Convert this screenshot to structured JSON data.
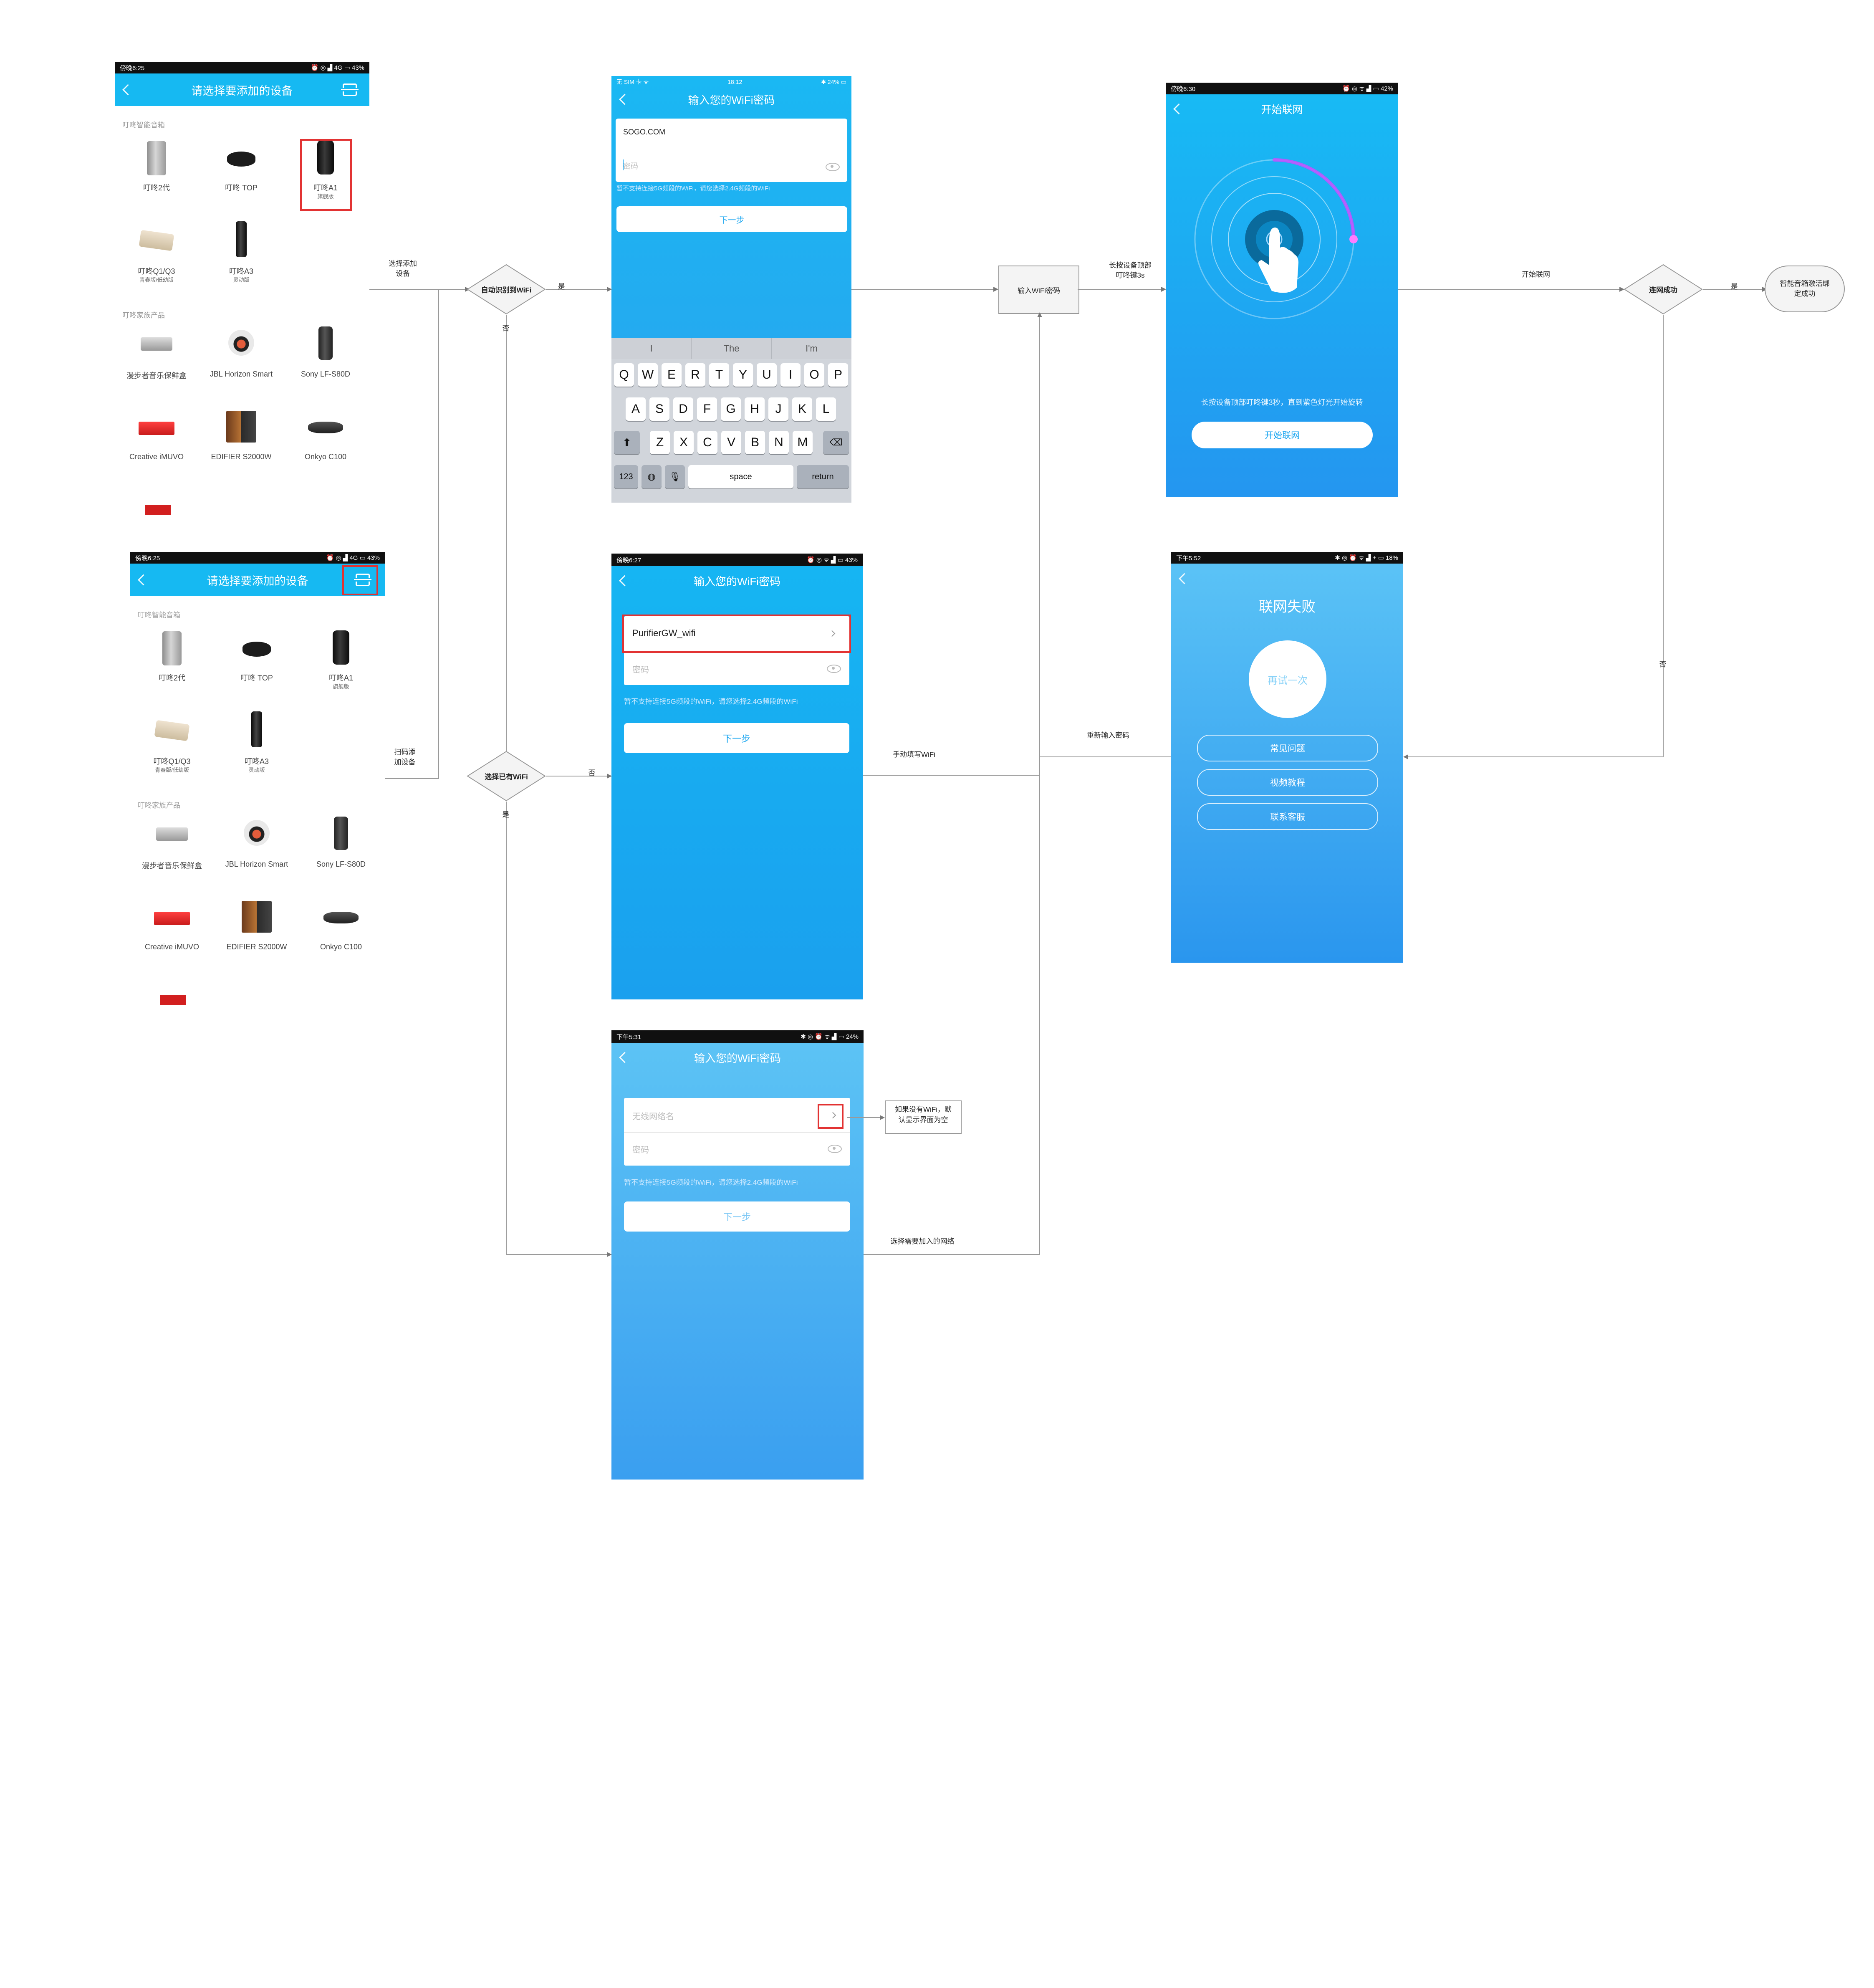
{
  "device_list": {
    "status_time": "傍晚6:25",
    "status_right": "⏰ ◎ ▟ 4G ▭ 43%",
    "title": "请选择要添加的设备",
    "section_smart": "叮咚智能音箱",
    "section_family": "叮咚家族产品",
    "items": [
      {
        "name": "叮咚2代",
        "sub": ""
      },
      {
        "name": "叮咚 TOP",
        "sub": ""
      },
      {
        "name": "叮咚A1",
        "sub": "旗舰版"
      },
      {
        "name": "叮咚Q1/Q3",
        "sub": "青春版/低幼版"
      },
      {
        "name": "叮咚A3",
        "sub": "灵动版"
      }
    ],
    "family_items": [
      {
        "name": "漫步者音乐保鲜盒"
      },
      {
        "name": "JBL Horizon Smart"
      },
      {
        "name": "Sony LF-S80D"
      },
      {
        "name": "Creative iMUVO"
      },
      {
        "name": "EDIFIER S2000W"
      },
      {
        "name": "Onkyo C100"
      }
    ]
  },
  "wifi_ios": {
    "status_left": "无 SIM 卡 ᯤ",
    "status_time": "18:12",
    "status_right": "✱ 24% ▭",
    "title": "输入您的WiFi密码",
    "ssid": "SOGO.COM",
    "password_placeholder": "密码",
    "hint": "暂不支持连接5G频段的WiFi，请您选择2.4G频段的WiFi",
    "next": "下一步",
    "suggestions": [
      "I",
      "The",
      "I'm"
    ],
    "row1": [
      "Q",
      "W",
      "E",
      "R",
      "T",
      "Y",
      "U",
      "I",
      "O",
      "P"
    ],
    "row2": [
      "A",
      "S",
      "D",
      "F",
      "G",
      "H",
      "J",
      "K",
      "L"
    ],
    "row3": [
      "Z",
      "X",
      "C",
      "V",
      "B",
      "N",
      "M"
    ],
    "num_key": "123",
    "space": "space",
    "return": "return"
  },
  "wifi_android": {
    "status_time": "傍晚6:27",
    "status_right": "⏰ ◎ ᯤ ▟ ▭ 43%",
    "title": "输入您的WiFi密码",
    "ssid": "PurifierGW_wifi",
    "password_placeholder": "密码",
    "hint": "暂不支持连接5G频段的WiFi，请您选择2.4G频段的WiFi",
    "next": "下一步"
  },
  "wifi_empty": {
    "status_time": "下午5:31",
    "status_right": "✱ ◎ ⏰ ᯤ ▟ ▭ 24%",
    "title": "输入您的WiFi密码",
    "ssid_placeholder": "无线网络名",
    "password_placeholder": "密码",
    "hint": "暂不支持连接5G频段的WiFi，请您选择2.4G频段的WiFi",
    "next": "下一步"
  },
  "connect": {
    "status_time": "傍晚6:30",
    "status_right": "⏰ ◎ ᯤ ▟ ▭ 42%",
    "title": "开始联网",
    "instruction": "长按设备顶部叮咚键3秒，直到紫色灯光开始旋转",
    "button": "开始联网"
  },
  "fail": {
    "status_time": "下午5:52",
    "status_right": "✱ ◎ ⏰ ᯤ ▟ + ▭ 18%",
    "title": "联网失败",
    "retry": "再试一次",
    "faq": "常见问题",
    "video": "视频教程",
    "contact": "联系客服"
  },
  "flow": {
    "select_add": "选择添加\n设备",
    "scan_add": "扫码添\n加设备",
    "auto_detect": "自动识别到WiFi",
    "choose_existing": "选择已有WiFi",
    "yes": "是",
    "no": "否",
    "enter_pwd": "输入WiFi密码",
    "long_press": "长按设备顶部\n叮咚键3s",
    "start_connect": "开始联网",
    "connected": "连网成功",
    "bind_done": "智能音箱激活绑\n定成功",
    "manual_wifi": "手动填写WiFi",
    "reenter_pwd": "重新输入密码",
    "select_network": "选择需要加入的网络",
    "no_wifi_note": "如果没有WiFi，默\n认显示界面为空"
  },
  "colors": {
    "accent": "#16b9f2",
    "highlight_red": "#e23232",
    "dark_bar": "#101010"
  }
}
